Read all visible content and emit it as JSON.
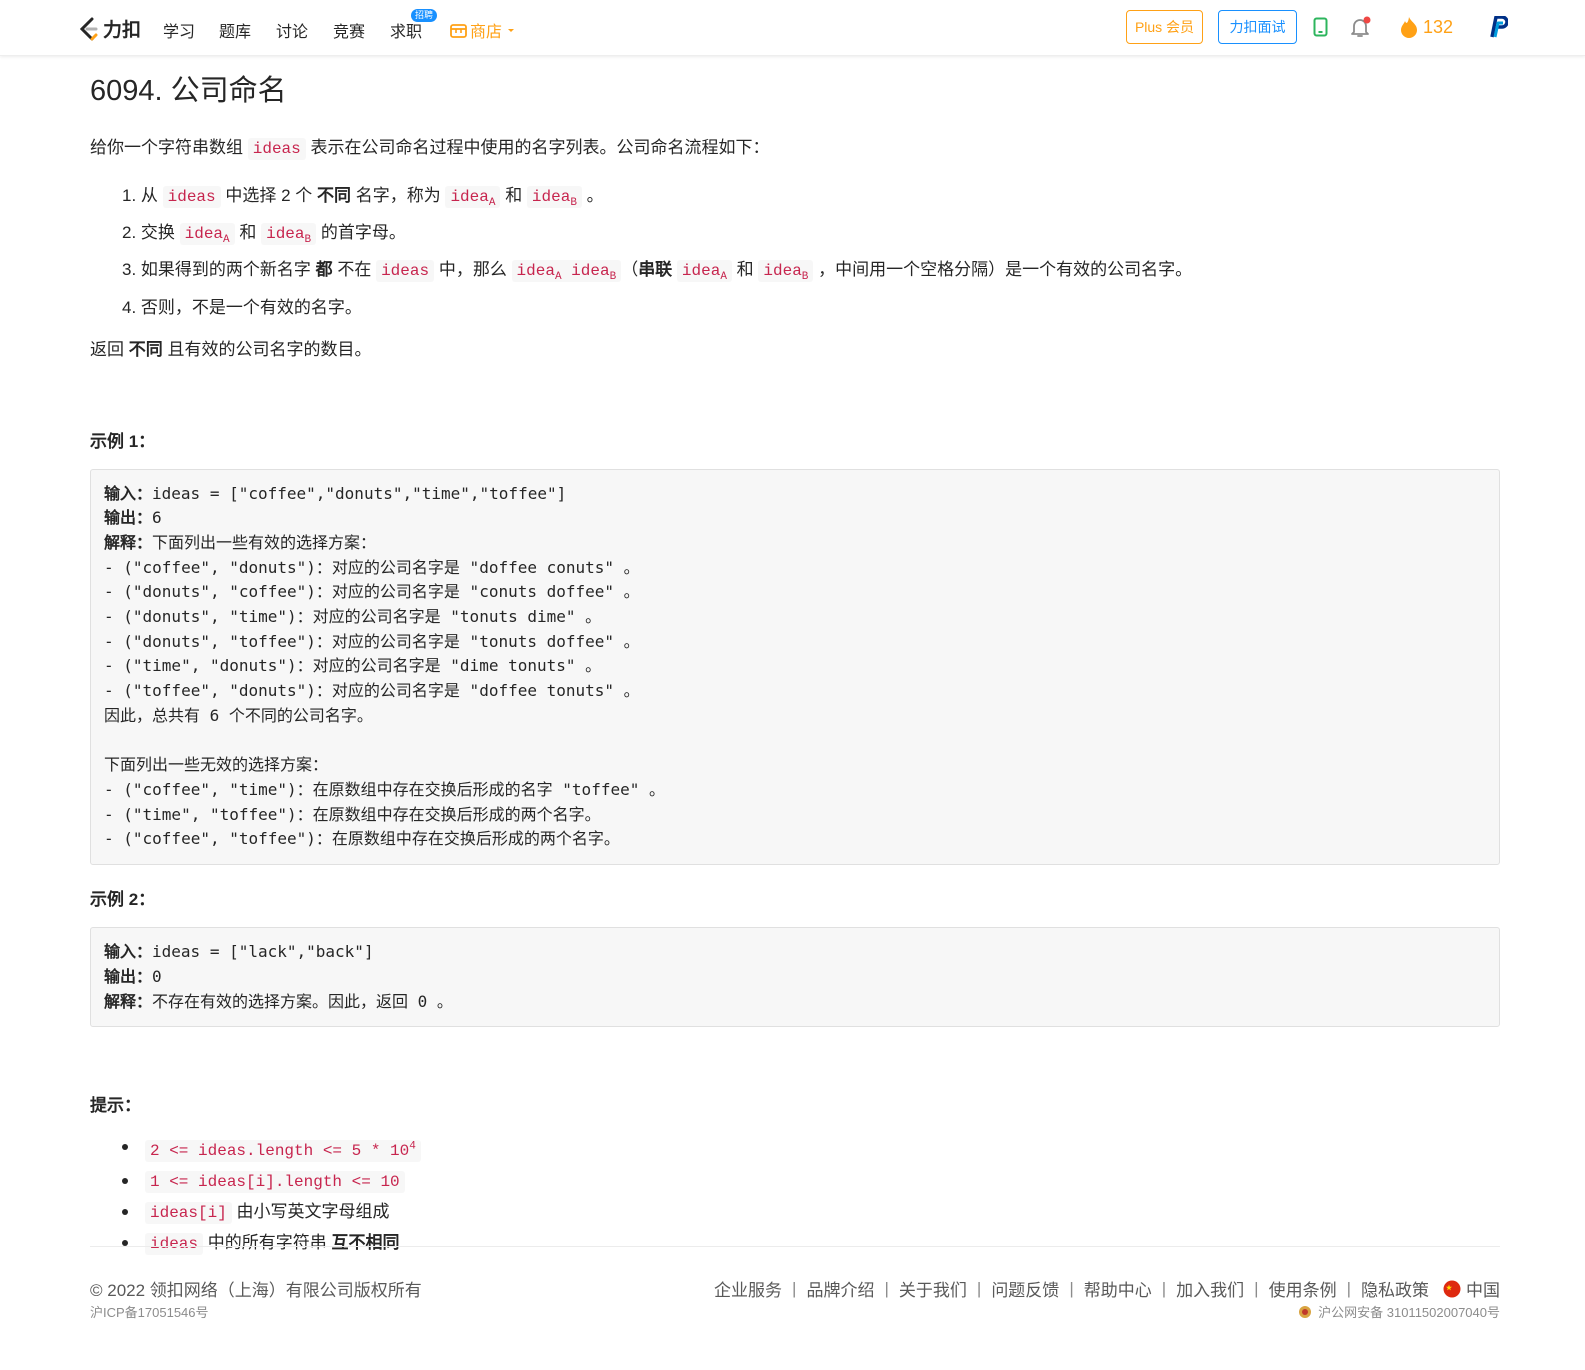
{
  "nav": {
    "logo_text": "力扣",
    "links": [
      "学习",
      "题库",
      "讨论",
      "竞赛",
      "求职"
    ],
    "job_badge": "招聘",
    "store": "商店",
    "plus": "Plus 会员",
    "interview": "力扣面试",
    "streak": "132"
  },
  "problem": {
    "title": "6094. 公司命名",
    "intro_1": "给你一个字符串数组 ",
    "intro_code": "ideas",
    "intro_2": " 表示在公司命名过程中使用的名字列表。公司命名流程如下：",
    "steps": {
      "s1_a": "1. 从 ",
      "s1_code": "ideas",
      "s1_b": " 中选择 2 个 ",
      "s1_bold": "不同",
      "s1_c": " 名字，称为 ",
      "s1_and": " 和 ",
      "s1_end": " 。",
      "s2_a": "2. 交换 ",
      "s2_and": " 和 ",
      "s2_end": " 的首字母。",
      "s3_a": "3. 如果得到的两个新名字 ",
      "s3_bold": "都",
      "s3_b": " 不在 ",
      "s3_code": "ideas",
      "s3_c": " 中，那么 ",
      "s3_d": "（",
      "s3_bold2": "串联",
      "s3_and": " 和 ",
      "s3_e": " ，中间用一个空格分隔）是一个有效的公司名字。",
      "s4": "4. 否则，不是一个有效的名字。",
      "idea": "idea",
      "sub_a": "A",
      "sub_b": "B"
    },
    "return_1": "返回 ",
    "return_bold": "不同",
    "return_2": " 且有效的公司名字的数目。",
    "example1_title": "示例 1：",
    "example2_title": "示例 2：",
    "label_input": "输入：",
    "label_output": "输出：",
    "label_explain": "解释：",
    "example1": {
      "input": "ideas = [\"coffee\",\"donuts\",\"time\",\"toffee\"]",
      "output": "6",
      "explain_lines": [
        "下面列出一些有效的选择方案：",
        "- (\"coffee\", \"donuts\")：对应的公司名字是 \"doffee conuts\" 。",
        "- (\"donuts\", \"coffee\")：对应的公司名字是 \"conuts doffee\" 。",
        "- (\"donuts\", \"time\")：对应的公司名字是 \"tonuts dime\" 。",
        "- (\"donuts\", \"toffee\")：对应的公司名字是 \"tonuts doffee\" 。",
        "- (\"time\", \"donuts\")：对应的公司名字是 \"dime tonuts\" 。",
        "- (\"toffee\", \"donuts\")：对应的公司名字是 \"doffee tonuts\" 。",
        "因此，总共有 6 个不同的公司名字。",
        "",
        "下面列出一些无效的选择方案：",
        "- (\"coffee\", \"time\")：在原数组中存在交换后形成的名字 \"toffee\" 。",
        "- (\"time\", \"toffee\")：在原数组中存在交换后形成的两个名字。",
        "- (\"coffee\", \"toffee\")：在原数组中存在交换后形成的两个名字。"
      ]
    },
    "example2": {
      "input": "ideas = [\"lack\",\"back\"]",
      "output": "0",
      "explain": "不存在有效的选择方案。因此，返回 0 。"
    },
    "hints_title": "提示：",
    "hints": {
      "h1_code": "2 <= ideas.length <= 5 * 10",
      "h1_sup": "4",
      "h2_code": "1 <= ideas[i].length <= 10",
      "h3_code": "ideas[i]",
      "h3_text": " 由小写英文字母组成",
      "h4_code": "ideas",
      "h4_text": " 中的所有字符串 ",
      "h4_bold": "互不相同"
    }
  },
  "footer": {
    "copyright": "© 2022 领扣网络（上海）有限公司版权所有",
    "icp": "沪ICP备17051546号",
    "links": [
      "企业服务",
      "品牌介绍",
      "关于我们",
      "问题反馈",
      "帮助中心",
      "加入我们",
      "使用条例",
      "隐私政策"
    ],
    "region": "中国",
    "police": "沪公网安备 31011502007040号"
  },
  "colors": {
    "brand_orange": "#ffa116",
    "link_blue": "#1890ff",
    "code_red": "#c7254e"
  }
}
